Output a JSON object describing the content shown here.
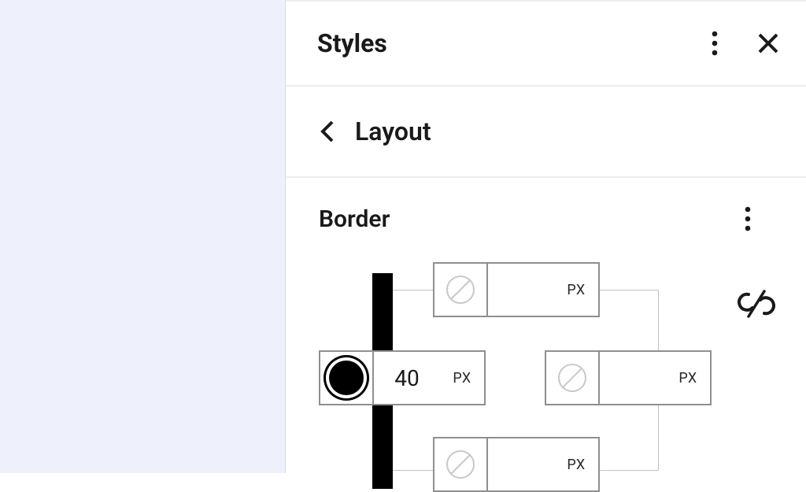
{
  "panel": {
    "title": "Styles"
  },
  "breadcrumb": {
    "current": "Layout"
  },
  "section": {
    "title": "Border"
  },
  "border": {
    "unit": "PX",
    "top": {
      "value": "",
      "color": "none"
    },
    "right": {
      "value": "",
      "color": "none"
    },
    "bottom": {
      "value": "",
      "color": "none"
    },
    "left": {
      "value": "40",
      "color": "solid-black"
    }
  }
}
